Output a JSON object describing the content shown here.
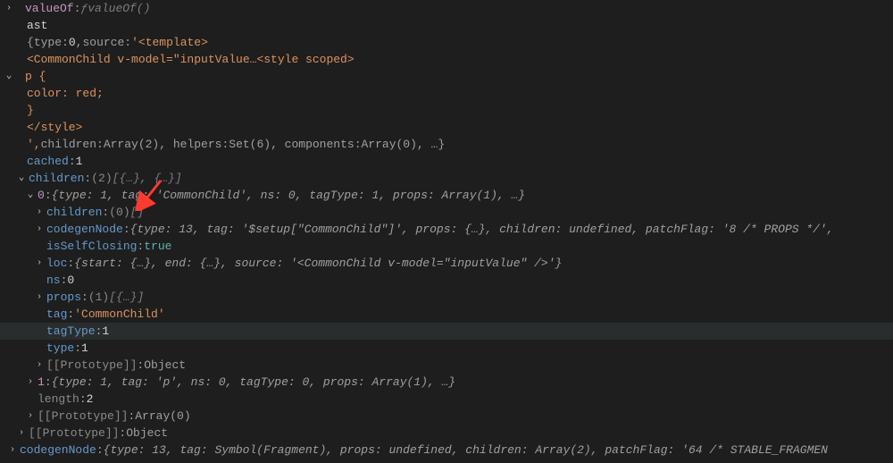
{
  "line0": {
    "valueOf": "valueOf",
    "fn": "valueOf()"
  },
  "l1": "ast",
  "l2": {
    "pre": "{",
    "k": "type",
    "v": "0",
    "k2": "source",
    "s": "'<template>"
  },
  "l3": "  <CommonChild v-model=\"inputValue…<style scoped>",
  "l4": "p {",
  "l5": "  color: red;",
  "l6": "  }",
  "l7": "  </style>",
  "l8": {
    "pre": "',",
    "kchildren": "children",
    "vchildren": "Array(2)",
    "khelpers": "helpers",
    "vhelpers": "Set(6)",
    "kcomp": "components",
    "vcomp": "Array(0)",
    "tail": ", …}"
  },
  "l9": {
    "k": "cached",
    "v": "1"
  },
  "l10": {
    "k": "children",
    "meta": "(2)",
    "arr": "[{…}, {…}]"
  },
  "l11": {
    "idx": "0",
    "obj": "{type: 1, tag: 'CommonChild', ns: 0, tagType: 1, props: Array(1), …}"
  },
  "l12": {
    "k": "children",
    "meta": "(0)",
    "arr": "[]"
  },
  "l13": {
    "k": "codegenNode",
    "obj": "{type: 13, tag: '$setup[\"CommonChild\"]', props: {…}, children: undefined, patchFlag: '8 /* PROPS */',"
  },
  "l14": {
    "k": "isSelfClosing",
    "v": "true"
  },
  "l15": {
    "k": "loc",
    "obj": "{start: {…}, end: {…}, source: '<CommonChild v-model=\"inputValue\" />'}"
  },
  "l16": {
    "k": "ns",
    "v": "0"
  },
  "l17": {
    "k": "props",
    "meta": "(1)",
    "arr": "[{…}]"
  },
  "l18": {
    "k": "tag",
    "v": "'CommonChild'"
  },
  "l19": {
    "k": "tagType",
    "v": "1"
  },
  "l20": {
    "k": "type",
    "v": "1"
  },
  "l21": {
    "k": "[[Prototype]]",
    "v": "Object"
  },
  "l22": {
    "idx": "1",
    "obj": "{type: 1, tag: 'p', ns: 0, tagType: 0, props: Array(1), …}"
  },
  "l23": {
    "k": "length",
    "v": "2"
  },
  "l24": {
    "k": "[[Prototype]]",
    "v": "Array(0)"
  },
  "l25": {
    "k": "[[Prototype]]",
    "v": "Object"
  },
  "l26": {
    "k": "codegenNode",
    "obj": "{type: 13, tag: Symbol(Fragment), props: undefined, children: Array(2), patchFlag: '64 /* STABLE_FRAGMEN"
  }
}
